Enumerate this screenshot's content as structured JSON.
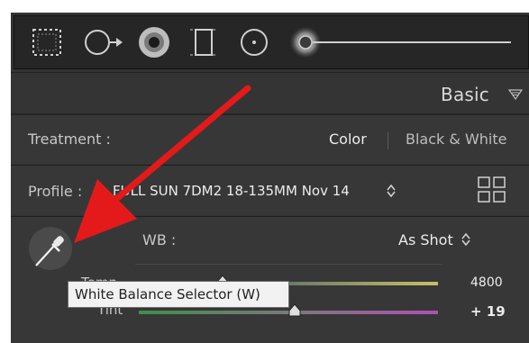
{
  "header": {
    "title": "Basic"
  },
  "treatment": {
    "label": "Treatment :",
    "options": [
      "Color",
      "Black & White"
    ],
    "selected": "Color"
  },
  "profile": {
    "label": "Profile :",
    "value": "FULL SUN 7DM2 18-135MM Nov 14"
  },
  "white_balance": {
    "label": "WB :",
    "value": "As Shot",
    "temp_label": "Temp",
    "temp_value": "4800",
    "tint_label": "Tint",
    "tint_value": "+ 19",
    "tint_level": 0.52
  },
  "tooltip": {
    "text": "White Balance Selector (W)"
  },
  "colors": {
    "panel_bg": "#323232",
    "annotation_arrow": "#e41a1a",
    "tooltip_bg": "#f2f2f2"
  },
  "icons": [
    "crop-overlay-icon",
    "spot-removal-icon",
    "red-eye-icon",
    "graduated-filter-icon",
    "radial-filter-icon",
    "adjustment-brush-icon",
    "disclosure-triangle-icon",
    "profile-browser-grid-icon",
    "eyedropper-icon"
  ]
}
